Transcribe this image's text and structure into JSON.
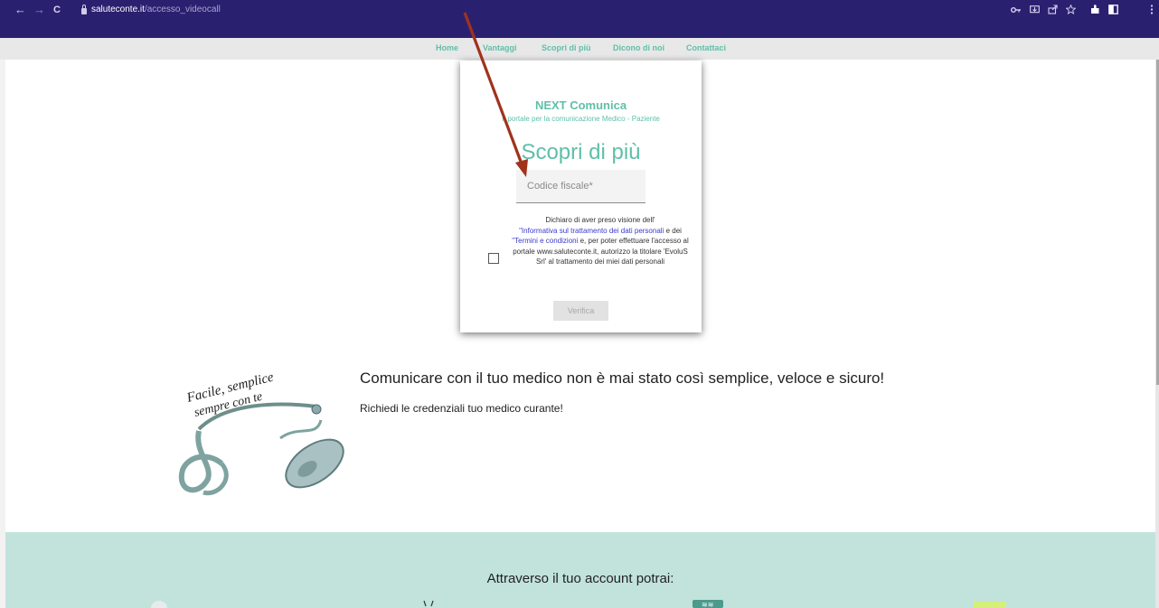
{
  "browser": {
    "back": "←",
    "forward": "→",
    "reload": "C",
    "url_domain": "saluteconte.it",
    "url_path": "/accesso_videocall",
    "icons": [
      "key-icon",
      "install-icon",
      "share-icon",
      "star-icon",
      "extensions-icon",
      "sidepanel-icon",
      "menu-icon"
    ]
  },
  "nav": {
    "items": [
      "Home",
      "Vantaggi",
      "Scopri di più",
      "Dicono di noi",
      "Contattaci"
    ]
  },
  "card": {
    "brand": "NEXT Comunica",
    "tagline": "Il portale per la comunicazione Medico - Paziente",
    "title": "Scopri di più",
    "fiscal_code_placeholder": "Codice fiscale*",
    "consent_line1": "Dichiaro di aver preso visione dell'",
    "consent_link1": "\"Informativa sul trattamento dei dati personali",
    "consent_mid": " e dei ",
    "consent_link2": "\"Termini e condizioni",
    "consent_rest": " e, per poter effettuare l'accesso al portale www.saluteconte.it, autorizzo la titolare 'EvoluS Srl' al trattamento dei miei dati personali",
    "verify_label": "Verifica"
  },
  "promo": {
    "image_caption_1": "Facile, semplice",
    "image_caption_2": "sempre con te",
    "headline": "Comunicare con il tuo medico non è mai stato così semplice, veloce e sicuro!",
    "subline": "Richiedi le credenziali tuo medico curante!"
  },
  "band": {
    "heading": "Attraverso il tuo account potrai:"
  },
  "colors": {
    "browser_bar": "#2a2070",
    "accent": "#5fbfa8",
    "link": "#3a3acf",
    "band": "#c1e3dc",
    "annotation_arrow": "#a0321e"
  }
}
